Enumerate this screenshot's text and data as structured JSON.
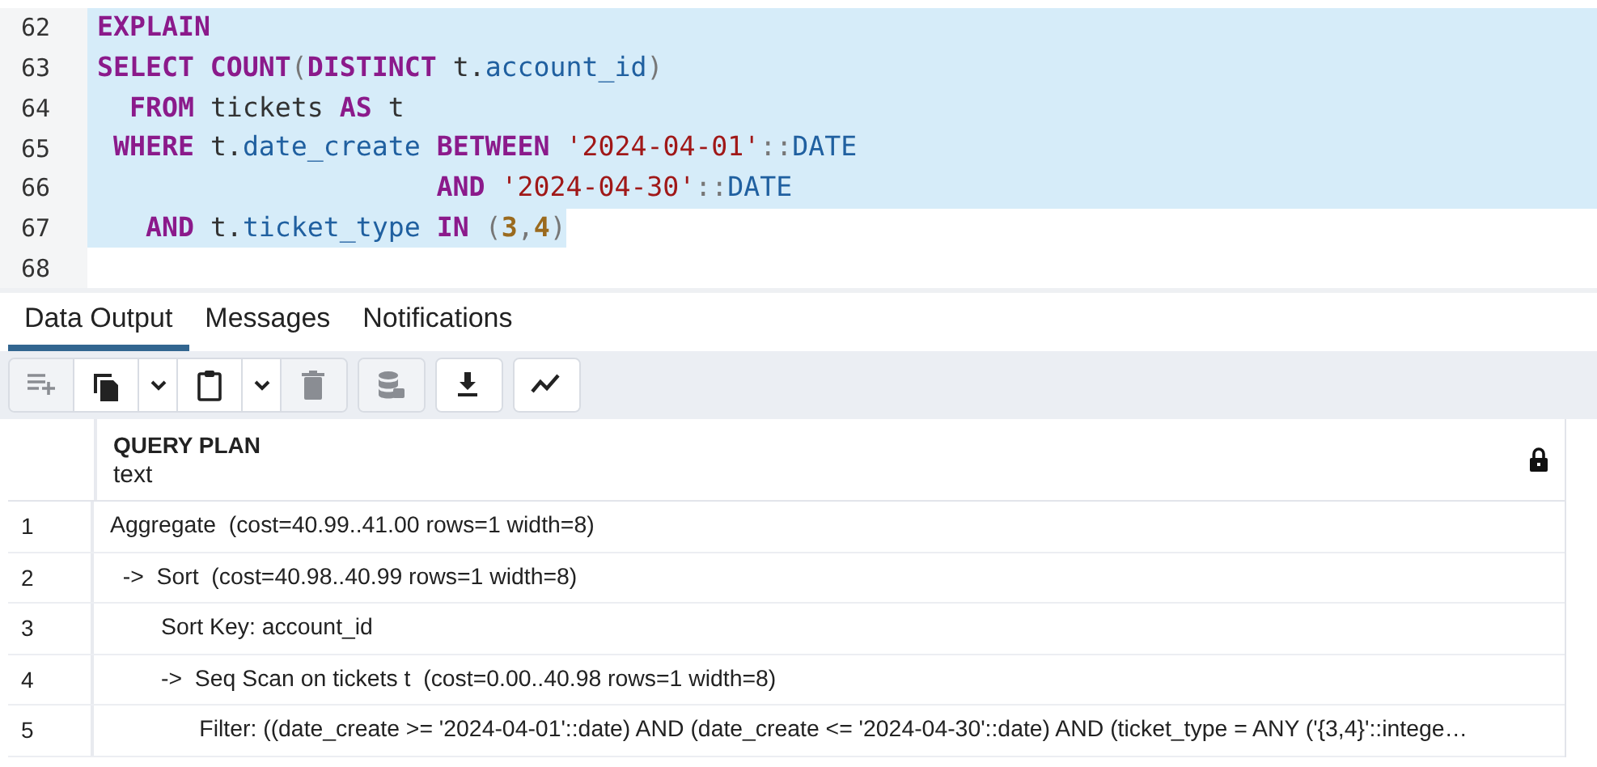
{
  "editor": {
    "lines": [
      {
        "number": "62",
        "selected": true,
        "full_width": true,
        "tokens": [
          {
            "kind": "keyword",
            "text": "EXPLAIN"
          }
        ]
      },
      {
        "number": "63",
        "selected": true,
        "full_width": true,
        "tokens": [
          {
            "kind": "keyword",
            "text": "SELECT COUNT"
          },
          {
            "kind": "punct",
            "text": "("
          },
          {
            "kind": "keyword",
            "text": "DISTINCT"
          },
          {
            "kind": "plain",
            "text": " t."
          },
          {
            "kind": "field",
            "text": "account_id"
          },
          {
            "kind": "punct",
            "text": ")"
          }
        ]
      },
      {
        "number": "64",
        "selected": true,
        "full_width": true,
        "tokens": [
          {
            "kind": "keyword",
            "text": "  FROM"
          },
          {
            "kind": "plain",
            "text": " tickets "
          },
          {
            "kind": "keyword",
            "text": "AS"
          },
          {
            "kind": "plain",
            "text": " t"
          }
        ]
      },
      {
        "number": "65",
        "selected": true,
        "full_width": true,
        "tokens": [
          {
            "kind": "keyword",
            "text": " WHERE"
          },
          {
            "kind": "plain",
            "text": " t."
          },
          {
            "kind": "field",
            "text": "date_create"
          },
          {
            "kind": "keyword",
            "text": " BETWEEN"
          },
          {
            "kind": "string",
            "text": " '2024-04-01'"
          },
          {
            "kind": "punct",
            "text": "::"
          },
          {
            "kind": "type",
            "text": "DATE"
          }
        ]
      },
      {
        "number": "66",
        "selected": true,
        "full_width": true,
        "tokens": [
          {
            "kind": "keyword",
            "text": "                     AND"
          },
          {
            "kind": "string",
            "text": " '2024-04-30'"
          },
          {
            "kind": "punct",
            "text": "::"
          },
          {
            "kind": "type",
            "text": "DATE"
          }
        ]
      },
      {
        "number": "67",
        "selected": true,
        "full_width": false,
        "tokens": [
          {
            "kind": "keyword",
            "text": "   AND"
          },
          {
            "kind": "plain",
            "text": " t."
          },
          {
            "kind": "field",
            "text": "ticket_type"
          },
          {
            "kind": "keyword",
            "text": " IN"
          },
          {
            "kind": "punct",
            "text": " ("
          },
          {
            "kind": "number",
            "text": "3"
          },
          {
            "kind": "punct",
            "text": ","
          },
          {
            "kind": "number",
            "text": "4"
          },
          {
            "kind": "punct",
            "text": ")"
          }
        ]
      },
      {
        "number": "68",
        "selected": false,
        "full_width": false
      }
    ]
  },
  "tabs": [
    {
      "label": "Data Output",
      "selected": true
    },
    {
      "label": "Messages",
      "selected": false
    },
    {
      "label": "Notifications",
      "selected": false
    }
  ],
  "toolbar": {
    "groups": [
      [
        {
          "kind": "add-row",
          "disabled": true
        },
        {
          "kind": "copy",
          "disabled": false
        },
        {
          "kind": "caret",
          "disabled": false
        },
        {
          "kind": "paste",
          "disabled": false
        },
        {
          "kind": "caret",
          "disabled": false
        },
        {
          "kind": "delete",
          "disabled": true
        }
      ],
      [
        {
          "kind": "database",
          "disabled": true
        }
      ],
      [
        {
          "kind": "download",
          "disabled": false
        }
      ],
      [
        {
          "kind": "graph",
          "disabled": false
        }
      ]
    ]
  },
  "grid": {
    "column": {
      "name": "QUERY PLAN",
      "type": "text",
      "locked": true
    },
    "rows": [
      {
        "number": "1",
        "value": "Aggregate  (cost=40.99..41.00 rows=1 width=8)"
      },
      {
        "number": "2",
        "value": "  ->  Sort  (cost=40.98..40.99 rows=1 width=8)"
      },
      {
        "number": "3",
        "value": "        Sort Key: account_id"
      },
      {
        "number": "4",
        "value": "        ->  Seq Scan on tickets t  (cost=0.00..40.98 rows=1 width=8)"
      },
      {
        "number": "5",
        "value": "              Filter: ((date_create >= '2024-04-01'::date) AND (date_create <= '2024-04-30'::date) AND (ticket_type = ANY ('{3,4}'::intege…"
      }
    ]
  }
}
